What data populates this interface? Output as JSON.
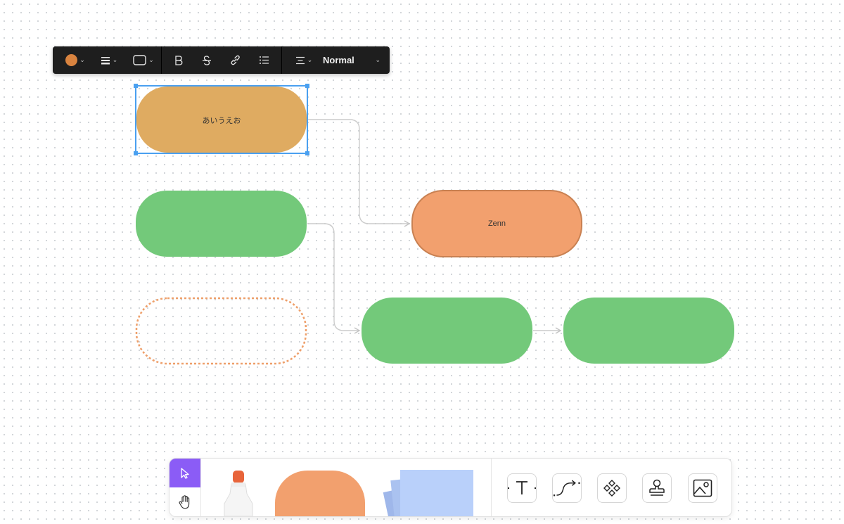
{
  "format_toolbar": {
    "fill_color": "#d9833f",
    "font_size": "Normal"
  },
  "canvas": {
    "shapes": [
      {
        "id": "shape-1",
        "label": "あいうえお",
        "fill": "#dfab61",
        "selected": true
      },
      {
        "id": "shape-2",
        "label": "",
        "fill": "#73c97a"
      },
      {
        "id": "shape-3",
        "label": "Zenn",
        "fill": "#f2a06e",
        "stroke": "#c98152"
      },
      {
        "id": "shape-4",
        "label": "",
        "fill": "none",
        "stroke": "#ee9f6a",
        "dashed": true
      },
      {
        "id": "shape-5",
        "label": "",
        "fill": "#73c97a"
      },
      {
        "id": "shape-6",
        "label": "",
        "fill": "#73c97a"
      }
    ],
    "selection_color": "#4aa0f0",
    "connector_color": "#cccccc"
  },
  "bottom_toolbar": {
    "mode_active_color": "#8b5cf6",
    "tools": [
      {
        "name": "select-tool"
      },
      {
        "name": "hand-tool"
      },
      {
        "name": "marker-tool"
      },
      {
        "name": "shape-tool"
      },
      {
        "name": "sticky-note-tool"
      },
      {
        "name": "text-tool"
      },
      {
        "name": "connector-tool"
      },
      {
        "name": "component-tool"
      },
      {
        "name": "stamp-tool"
      },
      {
        "name": "image-tool"
      }
    ]
  }
}
